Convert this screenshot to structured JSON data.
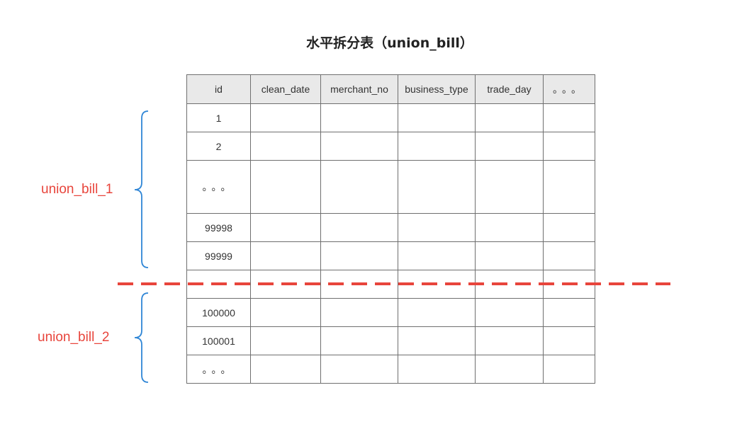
{
  "title": "水平拆分表（union_bill）",
  "table": {
    "columns": [
      "id",
      "clean_date",
      "merchant_no",
      "business_type",
      "trade_day",
      "。。。"
    ],
    "rows": [
      {
        "id": "1"
      },
      {
        "id": "2"
      },
      {
        "id": "。。。"
      },
      {
        "id": "99998"
      },
      {
        "id": "99999"
      },
      {
        "id": ""
      },
      {
        "id": "100000"
      },
      {
        "id": "100001"
      },
      {
        "id": "。。。"
      }
    ]
  },
  "shards": [
    {
      "label": "union_bill_1"
    },
    {
      "label": "union_bill_2"
    }
  ],
  "colors": {
    "divider": "#e8453c",
    "brace": "#2f86d6",
    "label": "#e8453c",
    "header_bg": "#e9e9e9"
  }
}
